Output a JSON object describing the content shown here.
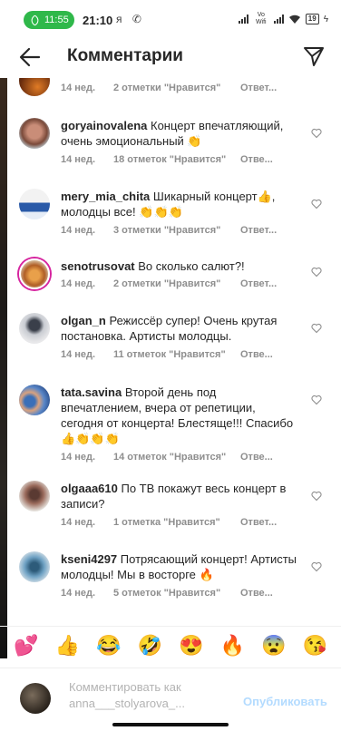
{
  "status_bar": {
    "call_time": "11:55",
    "clock": "21:10",
    "left_icons": "я ✆",
    "network": "Vo Wifi",
    "battery": "19"
  },
  "header": {
    "title": "Комментарии"
  },
  "top_partial": {
    "time": "14 нед.",
    "likes": "2 отметки \"Нравится\"",
    "reply": "Ответ..."
  },
  "comments": [
    {
      "username": "goryainovalena",
      "text": "Концерт впечатляющий, очень эмоциональный 👏",
      "time": "14 нед.",
      "likes": "18 отметок \"Нравится\"",
      "reply": "Отве..."
    },
    {
      "username": "mery_mia_chita",
      "text": "Шикарный концерт👍, молодцы все! 👏👏👏",
      "time": "14 нед.",
      "likes": "3 отметки \"Нравится\"",
      "reply": "Ответ..."
    },
    {
      "username": "senotrusovat",
      "text": "Во сколько салют?!",
      "time": "14 нед.",
      "likes": "2 отметки \"Нравится\"",
      "reply": "Ответ..."
    },
    {
      "username": "olgan_n",
      "text": "Режиссёр супер! Очень крутая постановка. Артисты молодцы.",
      "time": "14 нед.",
      "likes": "11 отметок \"Нравится\"",
      "reply": "Отве..."
    },
    {
      "username": "tata.savina",
      "text": "Второй день под впечатлением, вчера от репетиции, сегодня от концерта! Блестяще!!! Спасибо 👍👏👏👏",
      "time": "14 нед.",
      "likes": "14 отметок \"Нравится\"",
      "reply": "Отве..."
    },
    {
      "username": "olgaaa610",
      "text": "По ТВ покажут весь концерт в записи?",
      "time": "14 нед.",
      "likes": "1 отметка \"Нравится\"",
      "reply": "Ответ..."
    },
    {
      "username": "kseni4297",
      "text": "Потрясающий концерт! Артисты молодцы! Мы в восторге 🔥",
      "time": "14 нед.",
      "likes": "5 отметок \"Нравится\"",
      "reply": "Отве..."
    }
  ],
  "emoji_bar": [
    "💕",
    "👍",
    "😂",
    "🤣",
    "😍",
    "🔥",
    "😨",
    "😘"
  ],
  "composer": {
    "placeholder_line1": "Комментировать как",
    "placeholder_line2": "anna___stolyarova_...",
    "publish": "Опубликовать"
  },
  "colors": {
    "accent": "#0095f6",
    "publish_disabled": "#b3dbff",
    "meta_gray": "#8e8e8e",
    "call_green": "#2fb84a"
  }
}
